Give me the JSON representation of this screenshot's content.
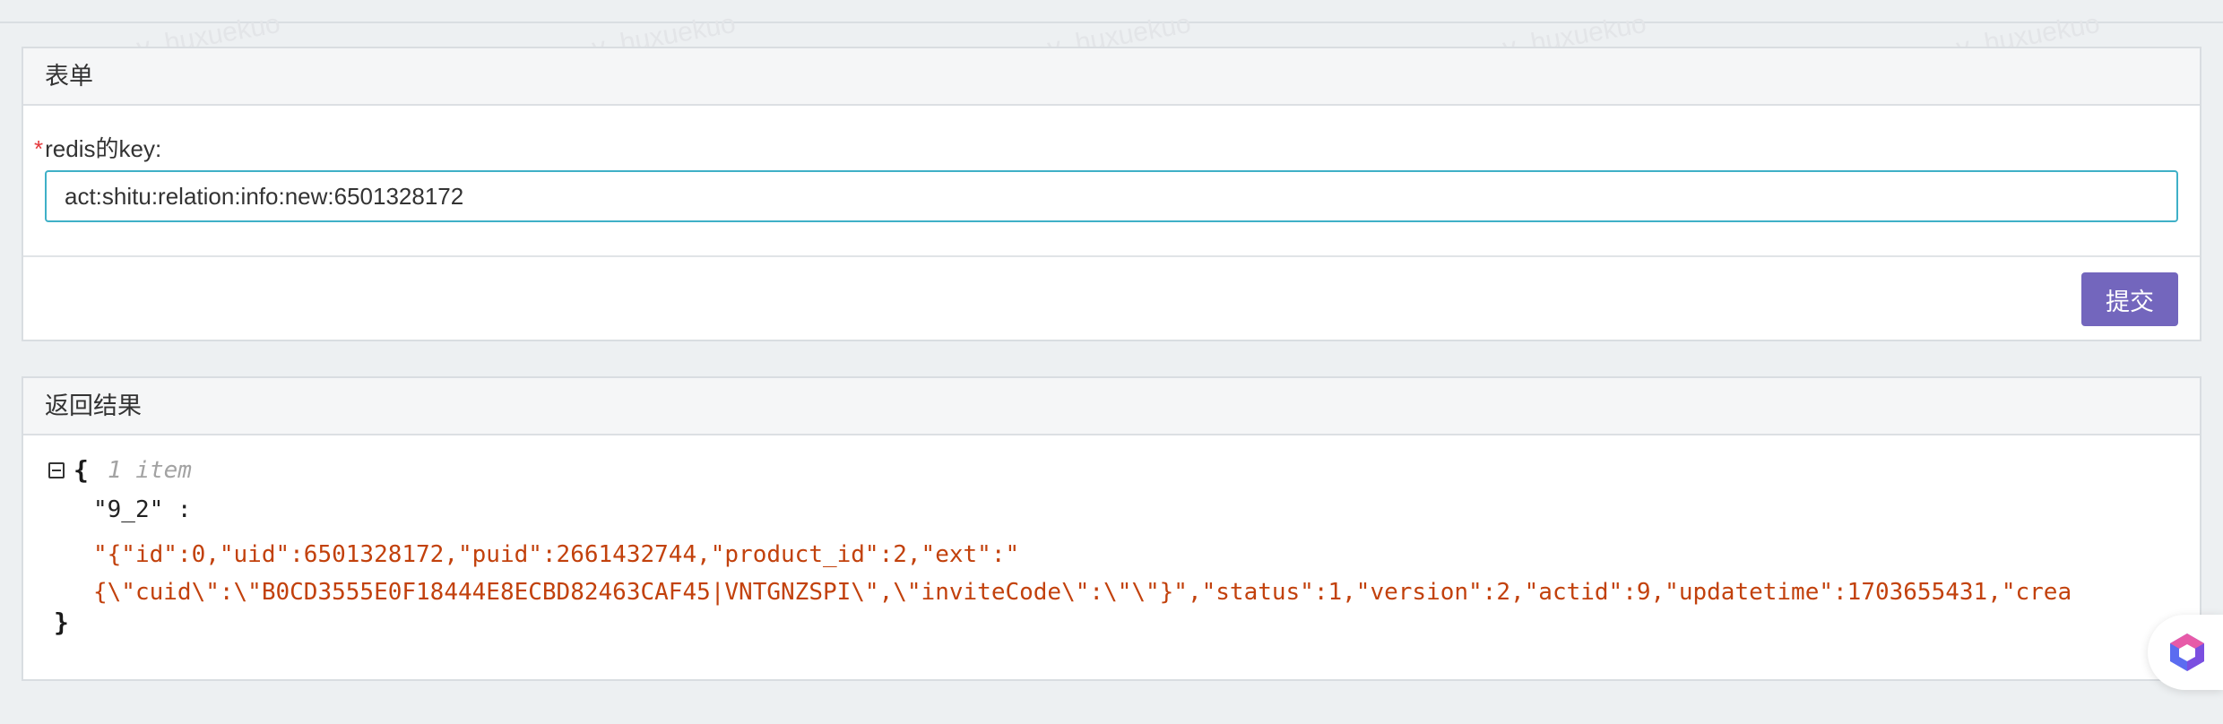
{
  "form_panel": {
    "title": "表单",
    "field": {
      "required_mark": "*",
      "label": "redis的key:",
      "value": "act:shitu:relation:info:new:6501328172"
    },
    "submit_label": "提交"
  },
  "result_panel": {
    "title": "返回结果",
    "json": {
      "open_brace": "{",
      "item_count": "1 item",
      "key": "\"9_2\" :",
      "value_line1": "\"{\"id\":0,\"uid\":6501328172,\"puid\":2661432744,\"product_id\":2,\"ext\":\"",
      "value_line2": "{\\\"cuid\\\":\\\"B0CD3555E0F18444E8ECBD82463CAF45|VNTGNZSPI\\\",\\\"inviteCode\\\":\\\"\\\"}\",\"status\":1,\"version\":2,\"actid\":9,\"updatetime\":1703655431,\"crea",
      "close_brace": "}"
    }
  },
  "watermark_text": "v_huxuekuo",
  "colors": {
    "accent": "#7366bd",
    "input_border": "#3fb0c7",
    "json_string": "#c2410c",
    "required": "#e4393c"
  },
  "icons": {
    "collapse": "minus-square-icon",
    "assistant": "cube-logo-icon"
  }
}
